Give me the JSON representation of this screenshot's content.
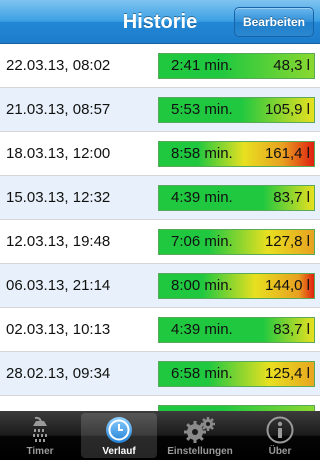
{
  "navbar": {
    "title": "Historie",
    "edit_button": "Bearbeiten"
  },
  "history": [
    {
      "date": "22.03.13, 08:02",
      "duration": "2:41 min.",
      "volume": "48,3 l",
      "fill": 0.3
    },
    {
      "date": "21.03.13, 08:57",
      "duration": "5:53 min.",
      "volume": "105,9 l",
      "fill": 0.66
    },
    {
      "date": "18.03.13, 12:00",
      "duration": "8:58 min.",
      "volume": "161,4 l",
      "fill": 1.0
    },
    {
      "date": "15.03.13, 12:32",
      "duration": "4:39 min.",
      "volume": "83,7 l",
      "fill": 0.52
    },
    {
      "date": "12.03.13, 19:48",
      "duration": "7:06 min.",
      "volume": "127,8 l",
      "fill": 0.79
    },
    {
      "date": "06.03.13, 21:14",
      "duration": "8:00 min.",
      "volume": "144,0 l",
      "fill": 0.89
    },
    {
      "date": "02.03.13, 10:13",
      "duration": "4:39 min.",
      "volume": "83,7 l",
      "fill": 0.52
    },
    {
      "date": "28.02.13, 09:34",
      "duration": "6:58 min.",
      "volume": "125,4 l",
      "fill": 0.78
    },
    {
      "date": "",
      "duration": "",
      "volume": "",
      "fill": 0.5
    }
  ],
  "tabs": [
    {
      "label": "Timer",
      "icon": "shower-icon",
      "selected": false
    },
    {
      "label": "Verlauf",
      "icon": "clock-icon",
      "selected": true
    },
    {
      "label": "Einstellungen",
      "icon": "gears-icon",
      "selected": false
    },
    {
      "label": "Über",
      "icon": "info-icon",
      "selected": false
    }
  ],
  "colors": {
    "navbar": "#2288d6",
    "row_alt": "#e8f1fb",
    "bar_low": "#20c840",
    "bar_mid": "#e8e020",
    "bar_high": "#e02010"
  }
}
